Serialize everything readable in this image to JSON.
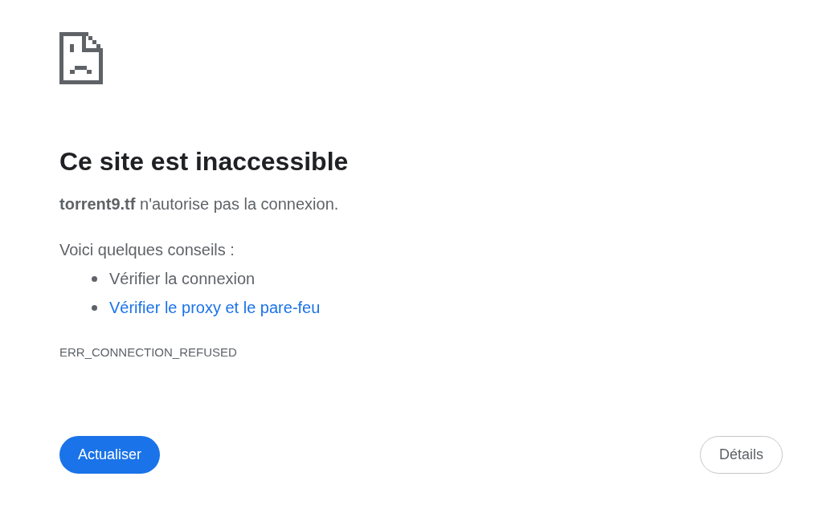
{
  "title": "Ce site est inaccessible",
  "message": "**torrent9.tf** n'autorise pas la connexion.",
  "suggestions": {
    "heading": "Voici quelques conseils :",
    "items": [
      {
        "kind": "text",
        "label": "Vérifier la connexion"
      },
      {
        "kind": "link",
        "label": "Vérifier le proxy et le pare-feu"
      }
    ]
  },
  "error_code": "ERR_CONNECTION_REFUSED",
  "buttons": [
    {
      "kind": "primary",
      "label": "Actualiser"
    },
    {
      "kind": "secondary",
      "label": "Détails"
    }
  ]
}
